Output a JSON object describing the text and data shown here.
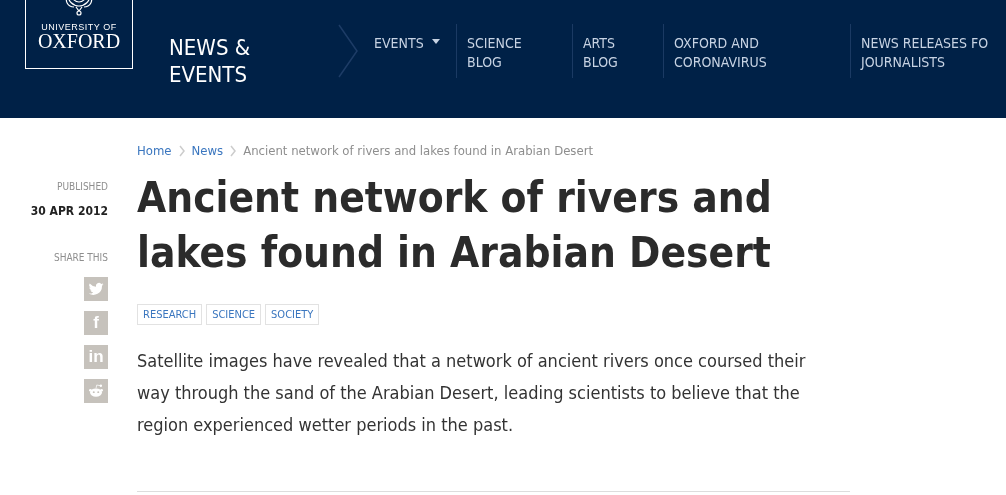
{
  "header": {
    "logo": {
      "line1": "UNIVERSITY OF",
      "line2": "OXFORD"
    },
    "section_title": [
      "NEWS &",
      "EVENTS"
    ],
    "nav": [
      {
        "label": [
          "EVENTS"
        ],
        "dropdown": true
      },
      {
        "label": [
          "SCIENCE",
          "BLOG"
        ],
        "dropdown": false
      },
      {
        "label": [
          "ARTS",
          "BLOG"
        ],
        "dropdown": false
      },
      {
        "label": [
          "OXFORD AND",
          "CORONAVIRUS"
        ],
        "dropdown": false
      },
      {
        "label": [
          "NEWS RELEASES FO",
          "JOURNALISTS"
        ],
        "dropdown": false
      }
    ]
  },
  "breadcrumbs": [
    {
      "label": "Home",
      "link": true
    },
    {
      "label": "News",
      "link": true
    },
    {
      "label": "Ancient network of rivers and lakes found in Arabian Desert",
      "link": false
    }
  ],
  "meta": {
    "published_label": "PUBLISHED",
    "date": "30 APR 2012",
    "share_label": "SHARE THIS",
    "share": [
      {
        "kind": "twitter"
      },
      {
        "kind": "facebook",
        "glyph": "f"
      },
      {
        "kind": "linkedin",
        "glyph": "in"
      },
      {
        "kind": "reddit"
      }
    ]
  },
  "article": {
    "title": "Ancient network of rivers and lakes found in Arabian Desert",
    "tags": [
      "RESEARCH",
      "SCIENCE",
      "SOCIETY"
    ],
    "summary": "Satellite images have revealed that a network of ancient rivers once coursed their way through the sand of the Arabian Desert, leading scientists to believe that the region experienced wetter periods in the past."
  }
}
